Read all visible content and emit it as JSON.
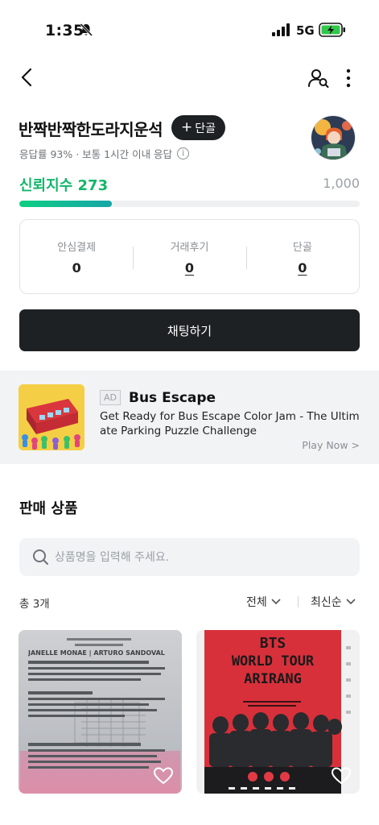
{
  "status_bar": {
    "time": "1:35",
    "network": "5G"
  },
  "shop": {
    "name": "반짝반짝한도라지운석",
    "follow_label": "단골",
    "response_info": "응답률 93% · 보통 1시간 이내 응답",
    "trust_label": "신뢰지수",
    "trust_score": "273",
    "trust_max": "1,000",
    "trust_progress_fraction": 0.273
  },
  "stats": [
    {
      "label": "안심결제",
      "value": "0"
    },
    {
      "label": "거래후기",
      "value": "0"
    },
    {
      "label": "단골",
      "value": "0"
    }
  ],
  "chat_button_label": "채팅하기",
  "ad": {
    "badge": "AD",
    "title": "Bus Escape",
    "description": "Get Ready for Bus Escape Color Jam - The Ultimate Parking Puzzle Challenge",
    "cta": "Play Now >"
  },
  "products_section": {
    "title": "판매 상품",
    "search_placeholder": "상품명을 입력해 주세요.",
    "count_label": "총 3개",
    "filter_label": "전체",
    "sort_label": "최신순"
  },
  "products": [
    {
      "poster_heading": "JANELLE MONAE | ARTURO SANDOVAL"
    },
    {
      "poster_line1": "BTS",
      "poster_line2": "WORLD TOUR",
      "poster_line3": "ARIRANG"
    }
  ],
  "colors": {
    "accent_green": "#12b76a",
    "dark_button": "#1e2124"
  },
  "icons": [
    "back-arrow-icon",
    "profile-search-icon",
    "more-vertical-icon",
    "info-icon",
    "search-icon",
    "chevron-down-icon",
    "heart-icon",
    "bell-off-icon",
    "signal-icon",
    "battery-charging-icon"
  ]
}
